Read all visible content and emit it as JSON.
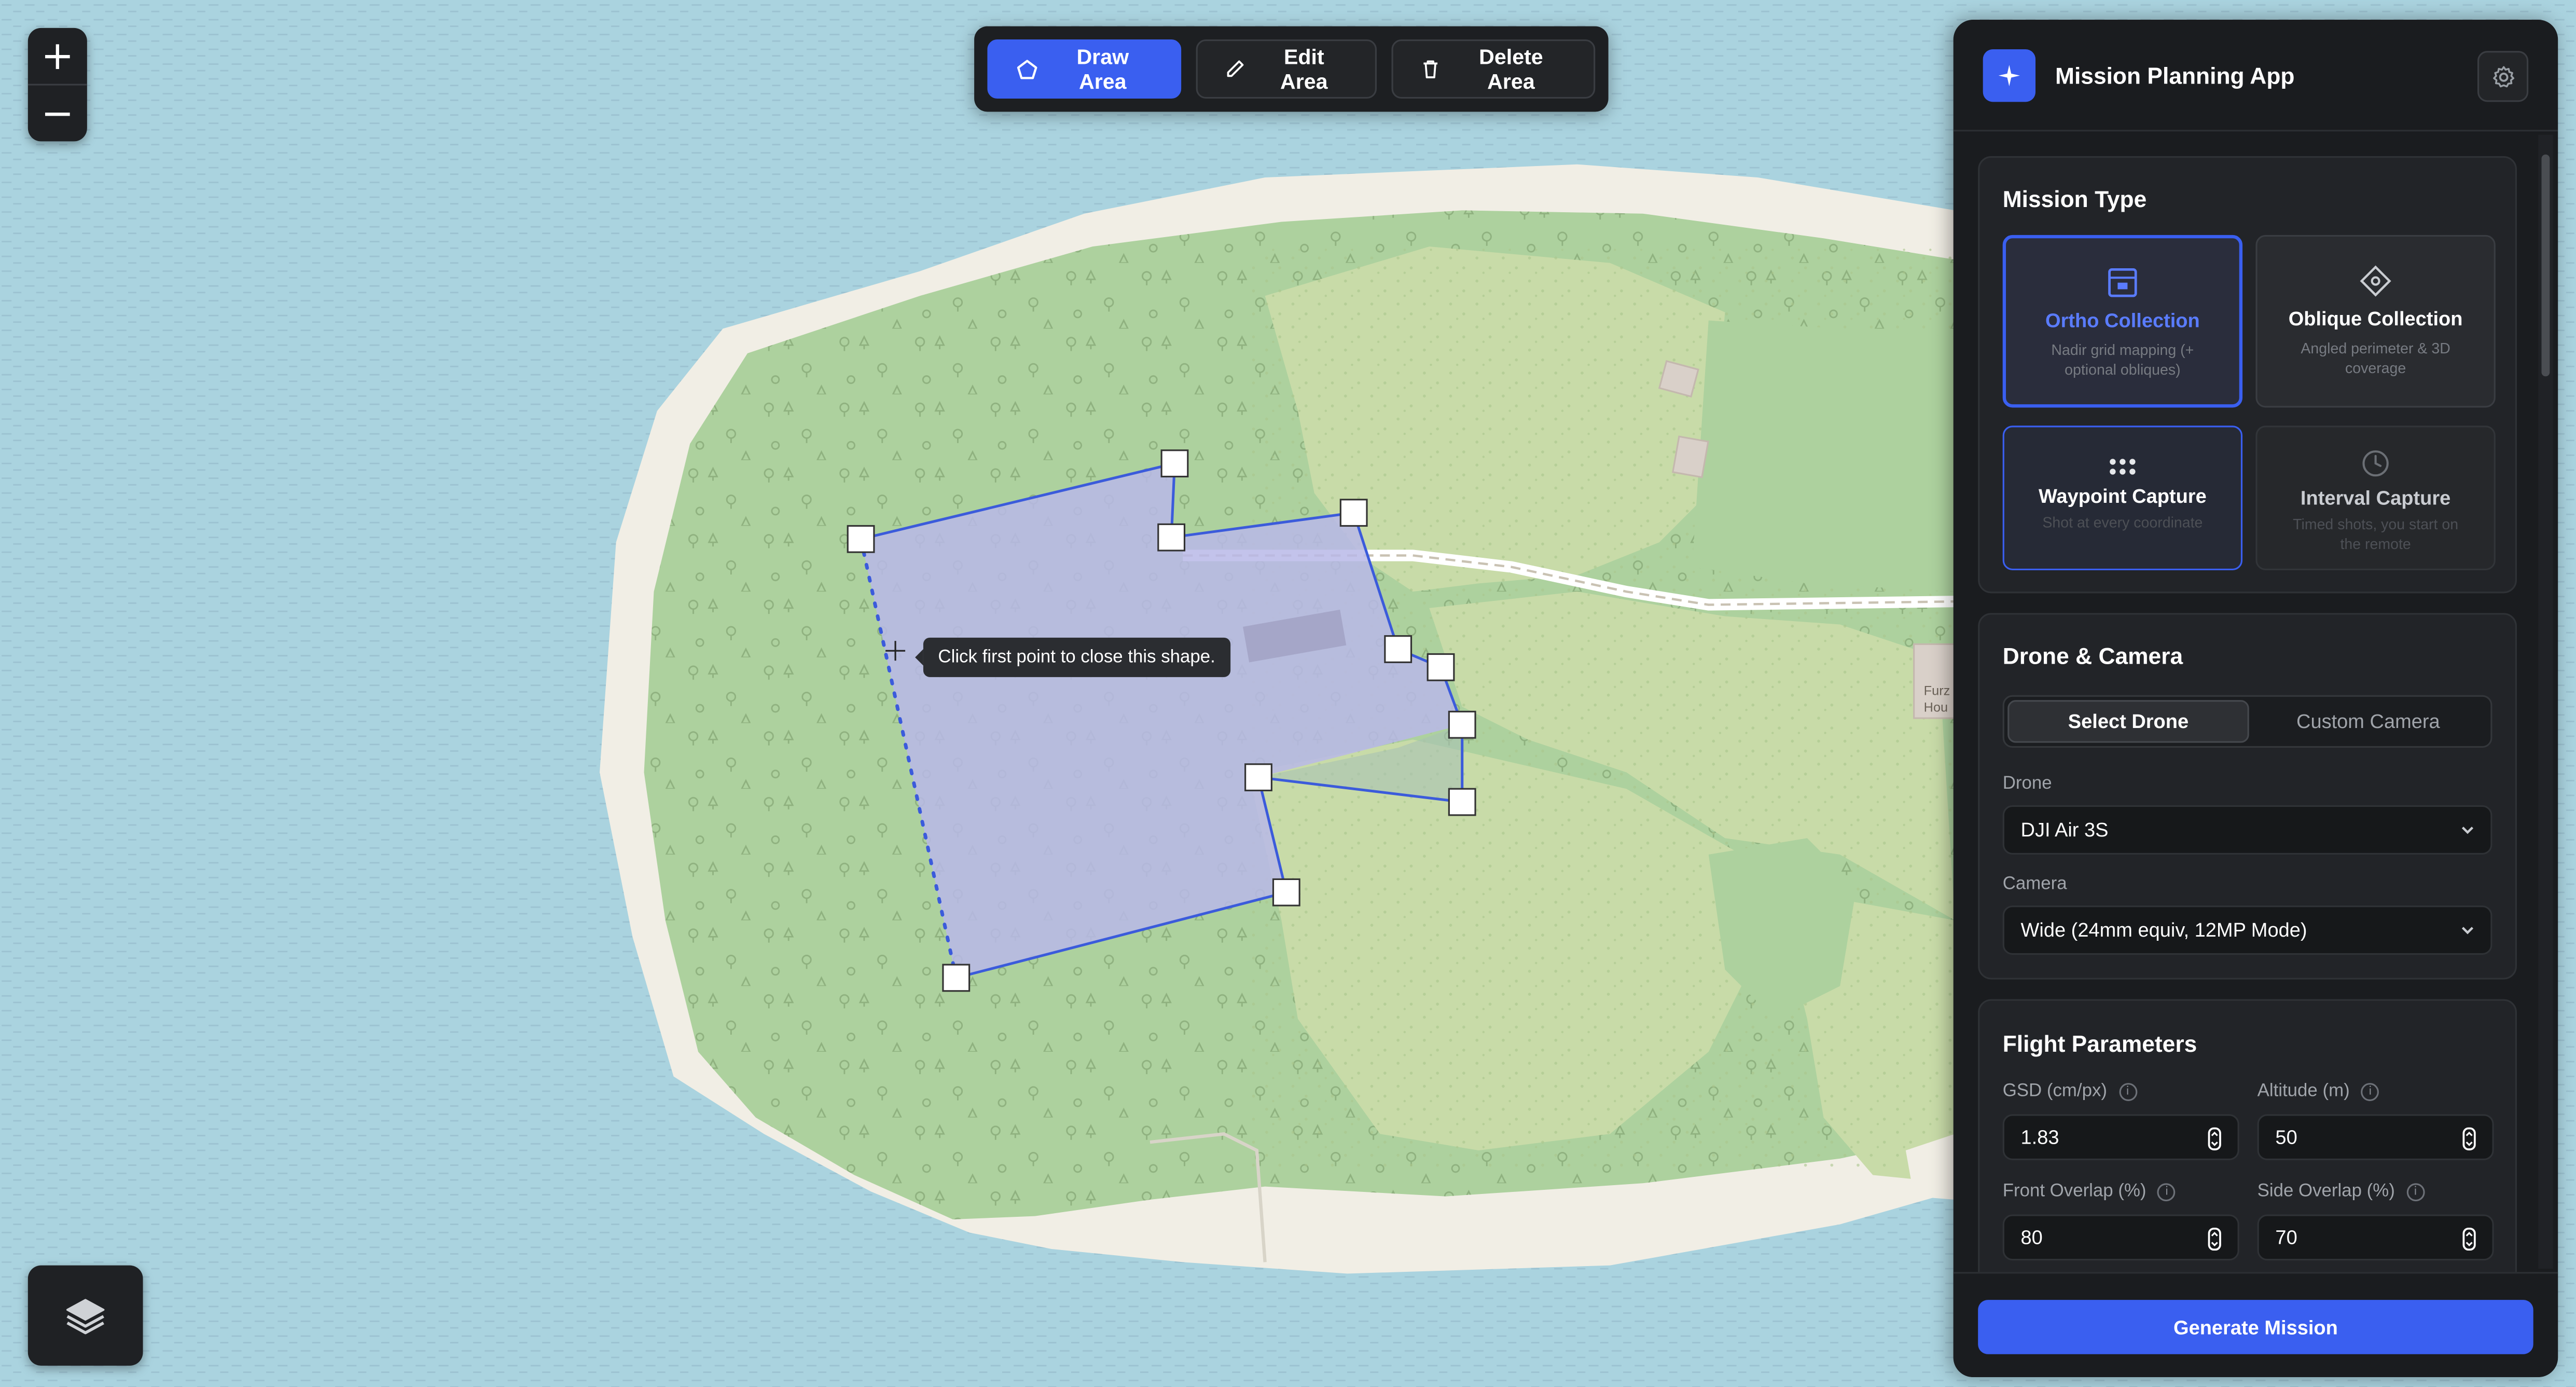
{
  "map": {
    "zoom_in_label": "+",
    "zoom_out_label": "−",
    "tooltip": "Click first point to close this shape.",
    "place_label_1": "Furz",
    "place_label_2": "Hou",
    "colors": {
      "water": "#aad3df",
      "woodland": "#add19e",
      "grass": "#c8dba8",
      "sand": "#f1eee5",
      "polygon": "#b9b8e8",
      "polygon_stroke": "#3b5bdb"
    }
  },
  "toolbar": {
    "draw_label": "Draw Area",
    "edit_label": "Edit Area",
    "delete_label": "Delete Area",
    "accent": "#3a5ff0"
  },
  "panel": {
    "title": "Mission Planning App",
    "mission_type": {
      "title": "Mission Type",
      "cards": [
        {
          "title": "Ortho Collection",
          "desc": "Nadir grid mapping (+ optional obliques)",
          "icon": "grid-map-icon",
          "selected": true
        },
        {
          "title": "Oblique Collection",
          "desc": "Angled perimeter & 3D coverage",
          "icon": "diamond-icon"
        },
        {
          "title": "Waypoint Capture",
          "desc": "Shot at every coordinate",
          "icon": "dots-grid-icon"
        },
        {
          "title": "Interval Capture",
          "desc": "Timed shots, you start on the remote",
          "icon": "clock-icon"
        }
      ]
    },
    "drone_camera": {
      "title": "Drone & Camera",
      "tab_select": "Select Drone",
      "tab_custom": "Custom Camera",
      "drone_label": "Drone",
      "drone_value": "DJI Air 3S",
      "camera_label": "Camera",
      "camera_value": "Wide (24mm equiv, 12MP Mode)"
    },
    "flight": {
      "title": "Flight Parameters",
      "gsd_label": "GSD (cm/px)",
      "gsd_value": "1.83",
      "altitude_label": "Altitude (m)",
      "altitude_value": "50",
      "front_label": "Front Overlap (%)",
      "front_value": "80",
      "side_label": "Side Overlap (%)",
      "side_value": "70"
    },
    "generate_label": "Generate Mission"
  }
}
